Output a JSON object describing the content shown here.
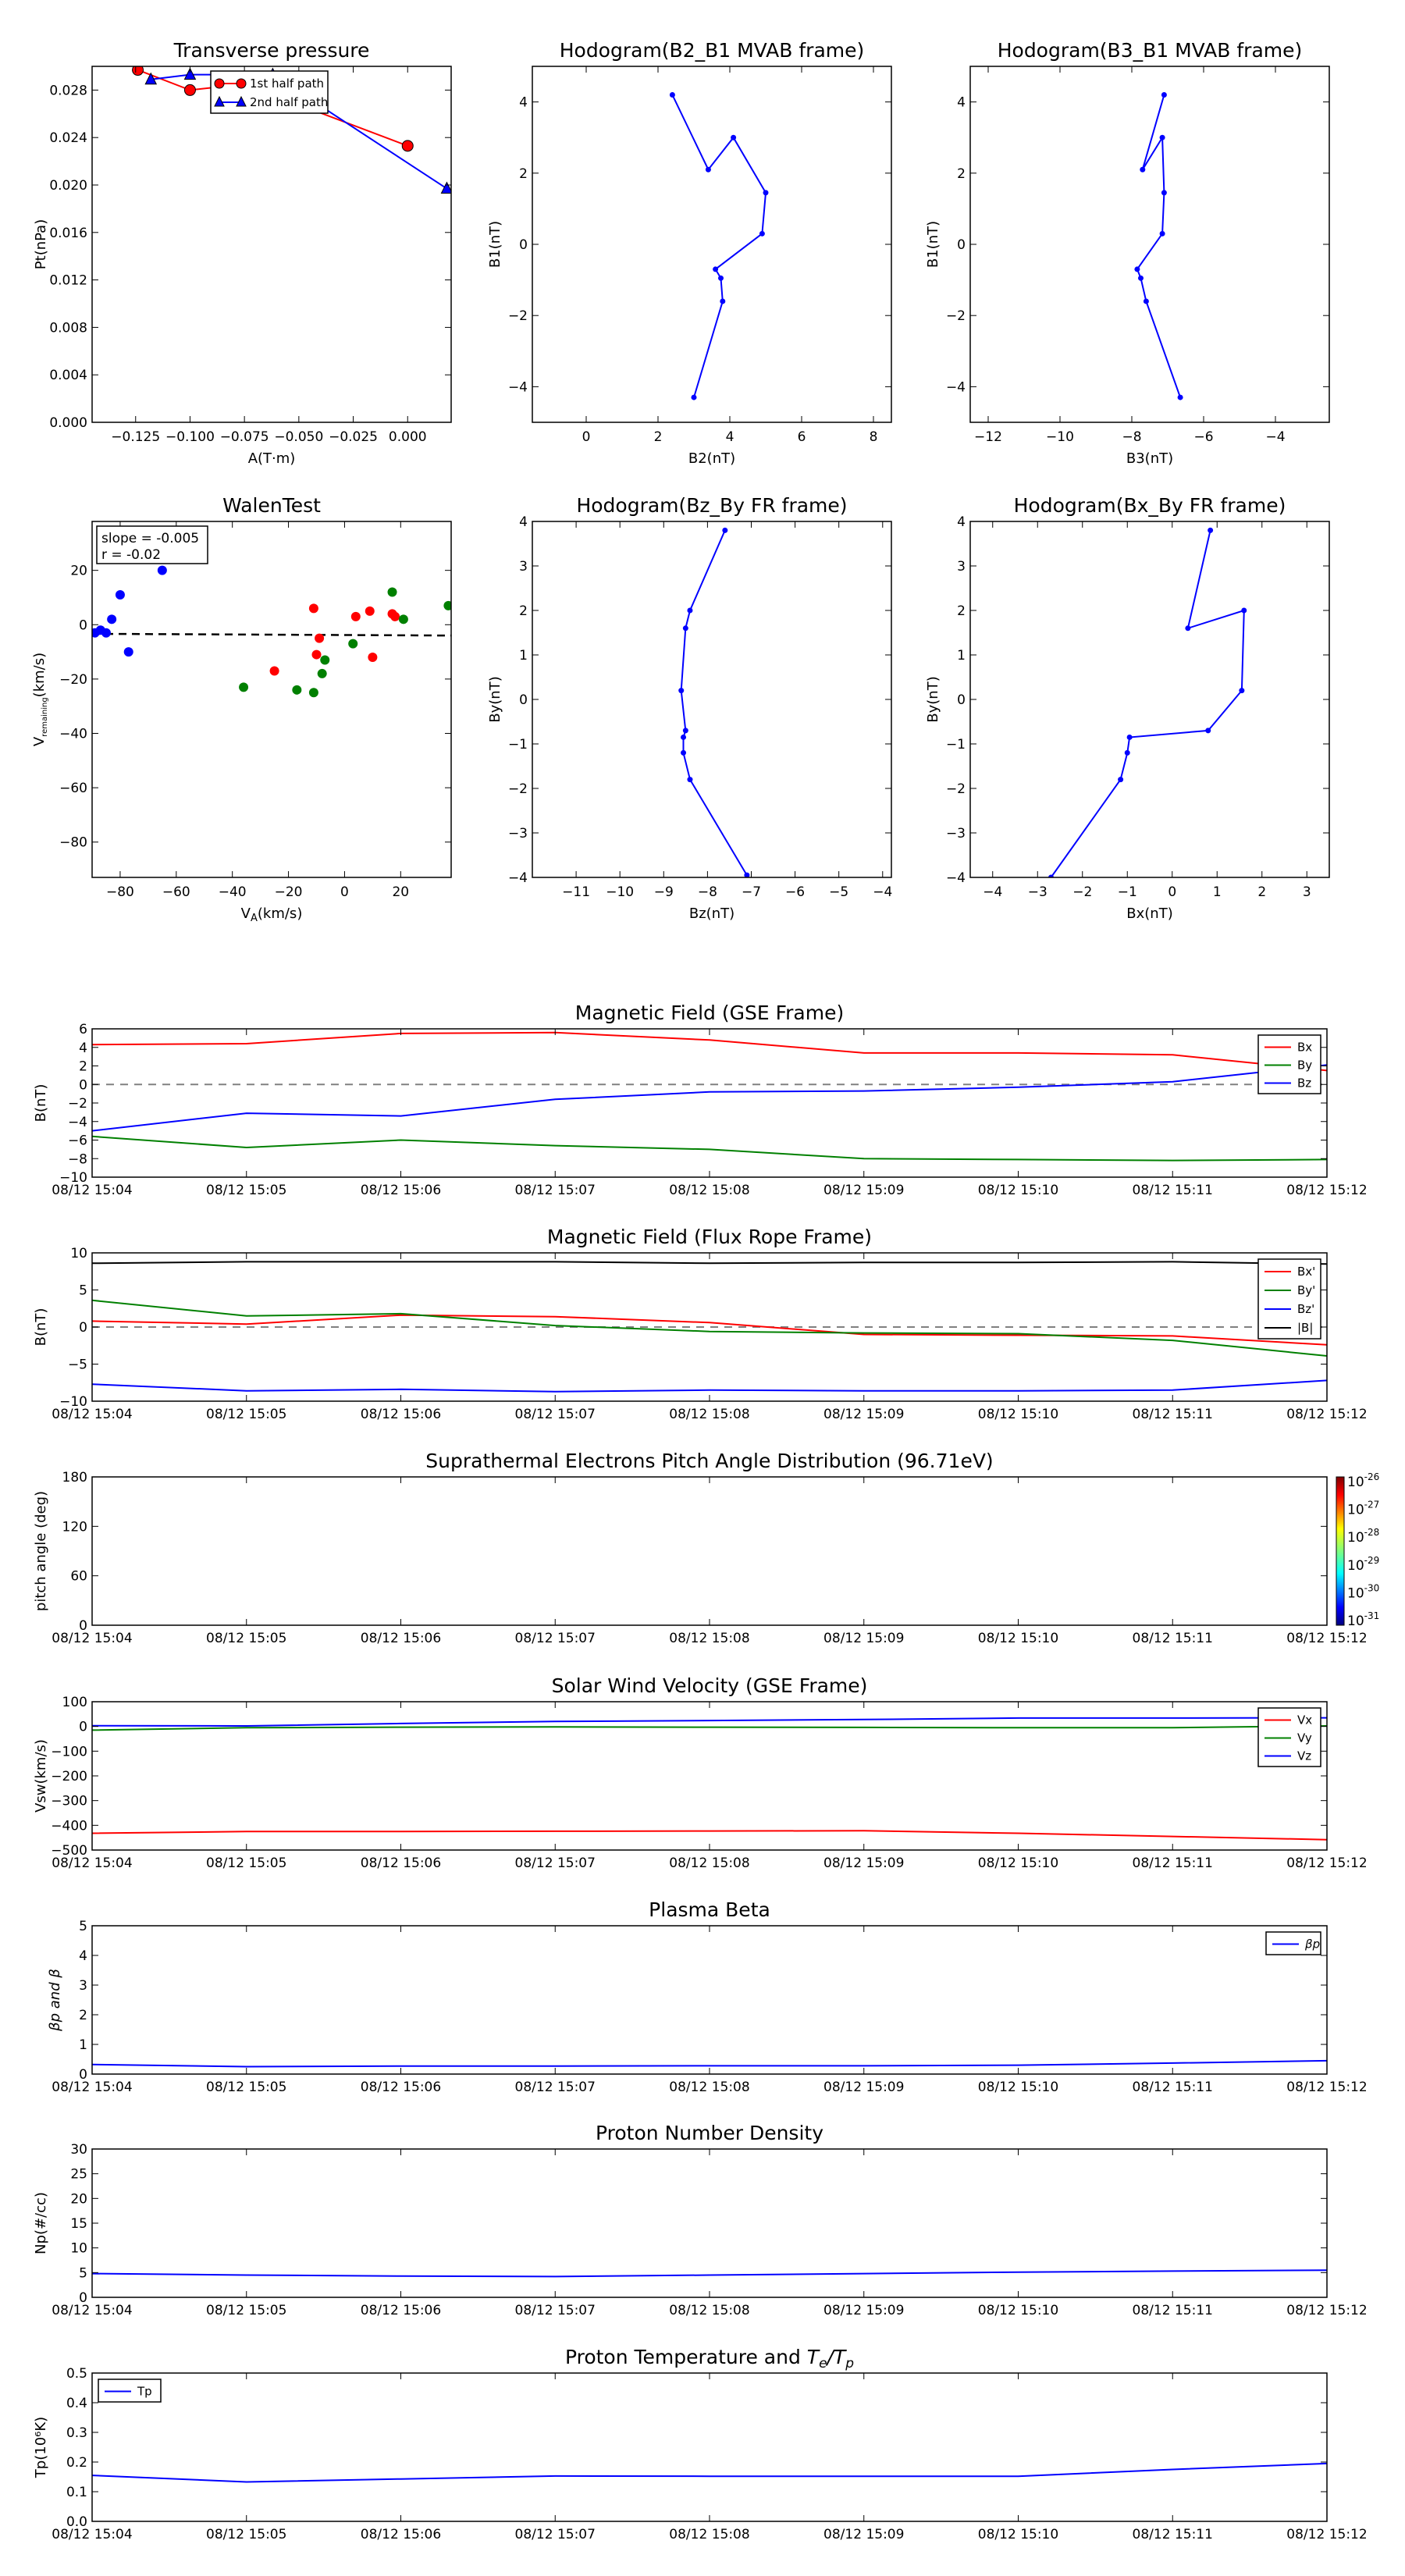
{
  "chart_data": [
    {
      "id": "tp",
      "type": "line",
      "title": "Transverse pressure",
      "xlabel": "A(T·m)",
      "ylabel": "Pt(nPa)",
      "xlim": [
        -0.145,
        0.02
      ],
      "ylim": [
        0,
        0.03
      ],
      "xticks": [
        -0.125,
        -0.1,
        -0.075,
        -0.05,
        -0.025,
        0.0
      ],
      "xtick_labels": [
        "−0.125",
        "−0.100",
        "−0.075",
        "−0.050",
        "−0.025",
        "0.000"
      ],
      "yticks": [
        0,
        0.004,
        0.008,
        0.012,
        0.016,
        0.02,
        0.024,
        0.028
      ],
      "ytick_labels": [
        "0.000",
        "0.004",
        "0.008",
        "0.012",
        "0.016",
        "0.020",
        "0.024",
        "0.028"
      ],
      "legend": {
        "location": "top-center"
      },
      "series": [
        {
          "name": "1st half path",
          "color": "#ff0000",
          "marker": "circle",
          "x": [
            -0.124,
            -0.1,
            -0.075,
            0.0
          ],
          "y": [
            0.0297,
            0.028,
            0.0285,
            0.0233
          ]
        },
        {
          "name": "2nd half path",
          "color": "#0000ff",
          "marker": "triangle",
          "x": [
            -0.118,
            -0.1,
            -0.062,
            0.018
          ],
          "y": [
            0.0289,
            0.0293,
            0.0293,
            0.0197
          ]
        }
      ]
    },
    {
      "id": "h21",
      "type": "line",
      "title": "Hodogram(B2_B1 MVAB frame)",
      "xlabel": "B2(nT)",
      "ylabel": "B1(nT)",
      "xlim": [
        -1.5,
        8.5
      ],
      "ylim": [
        -5,
        5
      ],
      "xticks": [
        0,
        2,
        4,
        6,
        8
      ],
      "xtick_labels": [
        "0",
        "2",
        "4",
        "6",
        "8"
      ],
      "yticks": [
        -4,
        -2,
        0,
        2,
        4
      ],
      "ytick_labels": [
        "−4",
        "−2",
        "0",
        "2",
        "4"
      ],
      "series": [
        {
          "color": "#0000ff",
          "marker": "dot",
          "x": [
            2.4,
            3.4,
            4.1,
            5.0,
            4.9,
            3.6,
            3.75,
            3.8,
            3.0
          ],
          "y": [
            4.2,
            2.1,
            3.0,
            1.45,
            0.3,
            -0.7,
            -0.95,
            -1.6,
            -4.3
          ]
        }
      ]
    },
    {
      "id": "h31",
      "type": "line",
      "title": "Hodogram(B3_B1 MVAB frame)",
      "xlabel": "B3(nT)",
      "ylabel": "B1(nT)",
      "xlim": [
        -12.5,
        -2.5
      ],
      "ylim": [
        -5,
        5
      ],
      "xticks": [
        -12,
        -10,
        -8,
        -6,
        -4
      ],
      "xtick_labels": [
        "−12",
        "−10",
        "−8",
        "−6",
        "−4"
      ],
      "yticks": [
        -4,
        -2,
        0,
        2,
        4
      ],
      "ytick_labels": [
        "−4",
        "−2",
        "0",
        "2",
        "4"
      ],
      "series": [
        {
          "color": "#0000ff",
          "marker": "dot",
          "x": [
            -7.1,
            -7.7,
            -7.15,
            -7.1,
            -7.15,
            -7.85,
            -7.75,
            -7.6,
            -6.65
          ],
          "y": [
            4.2,
            2.1,
            3.0,
            1.45,
            0.3,
            -0.7,
            -0.95,
            -1.6,
            -4.3
          ]
        }
      ]
    },
    {
      "id": "walen",
      "type": "scatter",
      "title": "WalenTest",
      "xlabel": "V_A(km/s)",
      "ylabel": "V_remaining(km/s)",
      "xlim": [
        -90,
        38
      ],
      "ylim": [
        -93,
        38
      ],
      "xticks": [
        -80,
        -60,
        -40,
        -20,
        0,
        20
      ],
      "xtick_labels": [
        "−80",
        "−60",
        "−40",
        "−20",
        "0",
        "20"
      ],
      "yticks": [
        -80,
        -60,
        -40,
        -20,
        0,
        20
      ],
      "ytick_labels": [
        "−80",
        "−60",
        "−40",
        "−20",
        "0",
        "20"
      ],
      "annotation": [
        "slope = -0.005",
        "r = -0.02"
      ],
      "fit": {
        "slope": -0.005,
        "intercept": -3.8,
        "color": "#000000",
        "style": "dashed"
      },
      "series": [
        {
          "color": "#0000ff",
          "x": [
            -89,
            -87,
            -85,
            -83,
            -80,
            -77,
            -65
          ],
          "y": [
            -3,
            -2,
            -3,
            2,
            11,
            -10,
            20
          ]
        },
        {
          "color": "#ff0000",
          "x": [
            -25,
            -11,
            -10,
            -9,
            4,
            9,
            17,
            18,
            10
          ],
          "y": [
            -17,
            6,
            -11,
            -5,
            3,
            5,
            4,
            3,
            -12
          ]
        },
        {
          "color": "#008000",
          "x": [
            -36,
            -17,
            -11,
            -8,
            -7,
            3,
            17,
            21,
            37
          ],
          "y": [
            -23,
            -24,
            -25,
            -18,
            -13,
            -7,
            12,
            2,
            7
          ]
        }
      ]
    },
    {
      "id": "hzy",
      "type": "line",
      "title": "Hodogram(Bz_By FR frame)",
      "xlabel": "Bz(nT)",
      "ylabel": "By(nT)",
      "xlim": [
        -12,
        -3.8
      ],
      "ylim": [
        -4,
        4
      ],
      "xticks": [
        -11,
        -10,
        -9,
        -8,
        -7,
        -6,
        -5,
        -4
      ],
      "xtick_labels": [
        "−11",
        "−10",
        "−9",
        "−8",
        "−7",
        "−6",
        "−5",
        "−4"
      ],
      "yticks": [
        -4,
        -3,
        -2,
        -1,
        0,
        1,
        2,
        3,
        4
      ],
      "ytick_labels": [
        "−4",
        "−3",
        "−2",
        "−1",
        "0",
        "1",
        "2",
        "3",
        "4"
      ],
      "series": [
        {
          "color": "#0000ff",
          "marker": "dot",
          "x": [
            -7.6,
            -8.4,
            -8.5,
            -8.6,
            -8.5,
            -8.55,
            -8.55,
            -8.4,
            -7.1
          ],
          "y": [
            3.8,
            2.0,
            1.6,
            0.2,
            -0.7,
            -0.85,
            -1.2,
            -1.8,
            -3.95
          ]
        }
      ]
    },
    {
      "id": "hxy",
      "type": "line",
      "title": "Hodogram(Bx_By FR frame)",
      "xlabel": "Bx(nT)",
      "ylabel": "By(nT)",
      "xlim": [
        -4.5,
        3.5
      ],
      "ylim": [
        -4,
        4
      ],
      "xticks": [
        -4,
        -3,
        -2,
        -1,
        0,
        1,
        2,
        3
      ],
      "xtick_labels": [
        "−4",
        "−3",
        "−2",
        "−1",
        "0",
        "1",
        "2",
        "3"
      ],
      "yticks": [
        -4,
        -3,
        -2,
        -1,
        0,
        1,
        2,
        3,
        4
      ],
      "ytick_labels": [
        "−4",
        "−3",
        "−2",
        "−1",
        "0",
        "1",
        "2",
        "3",
        "4"
      ],
      "series": [
        {
          "color": "#0000ff",
          "marker": "dot",
          "x": [
            0.85,
            0.35,
            1.6,
            1.55,
            0.8,
            -0.95,
            -1.0,
            -1.15,
            -2.7
          ],
          "y": [
            3.8,
            1.6,
            2.0,
            0.2,
            -0.7,
            -0.85,
            -1.2,
            -1.8,
            -4.0
          ]
        }
      ]
    },
    {
      "id": "mag_gse",
      "type": "line",
      "title": "Magnetic Field (GSE Frame)",
      "xlabel": "",
      "ylabel": "B(nT)",
      "xlim": [
        0,
        8
      ],
      "ylim": [
        -10,
        6
      ],
      "x": [
        0,
        1,
        2,
        3,
        4,
        5,
        6,
        7,
        8
      ],
      "x_tick_labels": [
        "08/12 15:04",
        "08/12 15:05",
        "08/12 15:06",
        "08/12 15:07",
        "08/12 15:08",
        "08/12 15:09",
        "08/12 15:10",
        "08/12 15:11",
        "08/12 15:12"
      ],
      "yticks": [
        -10,
        -8,
        -6,
        -4,
        -2,
        0,
        2,
        4,
        6
      ],
      "ytick_labels": [
        "−10",
        "−8",
        "−6",
        "−4",
        "−2",
        "0",
        "2",
        "4",
        "6"
      ],
      "zero_line": true,
      "legend": {
        "location": "top-right"
      },
      "series": [
        {
          "name": "Bx",
          "color": "#ff0000",
          "values": [
            4.3,
            4.4,
            5.5,
            5.6,
            4.8,
            3.4,
            3.4,
            3.2,
            1.5
          ]
        },
        {
          "name": "By",
          "color": "#008000",
          "values": [
            -5.6,
            -6.8,
            -6.0,
            -6.6,
            -7.0,
            -8.0,
            -8.1,
            -8.2,
            -8.1
          ]
        },
        {
          "name": "Bz",
          "color": "#0000ff",
          "values": [
            -5.0,
            -3.1,
            -3.4,
            -1.6,
            -0.8,
            -0.7,
            -0.3,
            0.3,
            2.1
          ]
        }
      ]
    },
    {
      "id": "mag_fr",
      "type": "line",
      "title": "Magnetic Field (Flux Rope Frame)",
      "xlabel": "",
      "ylabel": "B(nT)",
      "xlim": [
        0,
        8
      ],
      "ylim": [
        -10,
        10
      ],
      "x": [
        0,
        1,
        2,
        3,
        4,
        5,
        6,
        7,
        8
      ],
      "x_tick_labels": [
        "08/12 15:04",
        "08/12 15:05",
        "08/12 15:06",
        "08/12 15:07",
        "08/12 15:08",
        "08/12 15:09",
        "08/12 15:10",
        "08/12 15:11",
        "08/12 15:12"
      ],
      "yticks": [
        -10,
        -5,
        0,
        5,
        10
      ],
      "ytick_labels": [
        "−10",
        "−5",
        "0",
        "5",
        "10"
      ],
      "zero_line": true,
      "legend": {
        "location": "top-right"
      },
      "series": [
        {
          "name": "Bx'",
          "color": "#ff0000",
          "values": [
            0.8,
            0.4,
            1.6,
            1.4,
            0.6,
            -1.0,
            -1.1,
            -1.2,
            -2.4
          ]
        },
        {
          "name": "By'",
          "color": "#008000",
          "values": [
            3.6,
            1.5,
            1.8,
            0.2,
            -0.6,
            -0.8,
            -0.9,
            -1.8,
            -3.9
          ]
        },
        {
          "name": "Bz'",
          "color": "#0000ff",
          "values": [
            -7.7,
            -8.6,
            -8.4,
            -8.7,
            -8.5,
            -8.6,
            -8.6,
            -8.5,
            -7.2
          ]
        },
        {
          "name": "|B|",
          "color": "#000000",
          "values": [
            8.6,
            8.8,
            8.8,
            8.8,
            8.6,
            8.7,
            8.7,
            8.8,
            8.5
          ]
        }
      ]
    },
    {
      "id": "pad",
      "type": "heatmap",
      "title": "Suprathermal Electrons Pitch Angle Distribution (96.71eV)",
      "xlabel": "",
      "ylabel": "pitch angle (deg)",
      "xlim": [
        0,
        8
      ],
      "ylim": [
        0,
        180
      ],
      "x_tick_labels": [
        "08/12 15:04",
        "08/12 15:05",
        "08/12 15:06",
        "08/12 15:07",
        "08/12 15:08",
        "08/12 15:09",
        "08/12 15:10",
        "08/12 15:11",
        "08/12 15:12"
      ],
      "yticks": [
        0,
        60,
        120,
        180
      ],
      "ytick_labels": [
        "0",
        "60",
        "120",
        "180"
      ],
      "colorbar_exponents": [
        "-26",
        "-27",
        "-28",
        "-29",
        "-30",
        "-31"
      ],
      "colorbar_base": "10"
    },
    {
      "id": "vsw",
      "type": "line",
      "title": "Solar Wind Velocity (GSE Frame)",
      "xlabel": "",
      "ylabel": "Vsw(km/s)",
      "xlim": [
        0,
        8
      ],
      "ylim": [
        -500,
        100
      ],
      "x": [
        0,
        1,
        2,
        3,
        4,
        5,
        6,
        7,
        8
      ],
      "x_tick_labels": [
        "08/12 15:04",
        "08/12 15:05",
        "08/12 15:06",
        "08/12 15:07",
        "08/12 15:08",
        "08/12 15:09",
        "08/12 15:10",
        "08/12 15:11",
        "08/12 15:12"
      ],
      "yticks": [
        -500,
        -400,
        -300,
        -200,
        -100,
        0,
        100
      ],
      "ytick_labels": [
        "−500",
        "−400",
        "−300",
        "−200",
        "−100",
        "0",
        "100"
      ],
      "legend": {
        "location": "top-right"
      },
      "series": [
        {
          "name": "Vx",
          "color": "#ff0000",
          "values": [
            -432,
            -425,
            -425,
            -424,
            -423,
            -422,
            -432,
            -445,
            -458
          ]
        },
        {
          "name": "Vy",
          "color": "#008000",
          "values": [
            -15,
            -5,
            -3,
            -2,
            -3,
            -4,
            -5,
            -5,
            2
          ]
        },
        {
          "name": "Vz",
          "color": "#0000ff",
          "values": [
            3,
            2,
            12,
            20,
            24,
            28,
            34,
            34,
            35
          ]
        }
      ]
    },
    {
      "id": "beta",
      "type": "line",
      "title": "Plasma Beta",
      "xlabel": "",
      "ylabel": "βp and β",
      "xlim": [
        0,
        8
      ],
      "ylim": [
        0,
        5
      ],
      "x": [
        0,
        1,
        2,
        3,
        4,
        5,
        6,
        7,
        8
      ],
      "x_tick_labels": [
        "08/12 15:04",
        "08/12 15:05",
        "08/12 15:06",
        "08/12 15:07",
        "08/12 15:08",
        "08/12 15:09",
        "08/12 15:10",
        "08/12 15:11",
        "08/12 15:12"
      ],
      "yticks": [
        0,
        1,
        2,
        3,
        4,
        5
      ],
      "ytick_labels": [
        "0",
        "1",
        "2",
        "3",
        "4",
        "5"
      ],
      "legend": {
        "location": "top-right"
      },
      "series": [
        {
          "name": "βp",
          "color": "#0000ff",
          "values": [
            0.32,
            0.25,
            0.27,
            0.27,
            0.28,
            0.28,
            0.3,
            0.37,
            0.45
          ]
        }
      ]
    },
    {
      "id": "np",
      "type": "line",
      "title": "Proton Number Density",
      "xlabel": "",
      "ylabel": "Np(#/cc)",
      "xlim": [
        0,
        8
      ],
      "ylim": [
        0,
        30
      ],
      "x": [
        0,
        1,
        2,
        3,
        4,
        5,
        6,
        7,
        8
      ],
      "x_tick_labels": [
        "08/12 15:04",
        "08/12 15:05",
        "08/12 15:06",
        "08/12 15:07",
        "08/12 15:08",
        "08/12 15:09",
        "08/12 15:10",
        "08/12 15:11",
        "08/12 15:12"
      ],
      "yticks": [
        0,
        5,
        10,
        15,
        20,
        25,
        30
      ],
      "ytick_labels": [
        "0",
        "5",
        "10",
        "15",
        "20",
        "25",
        "30"
      ],
      "series": [
        {
          "color": "#0000ff",
          "values": [
            4.8,
            4.5,
            4.3,
            4.2,
            4.5,
            4.8,
            5.1,
            5.3,
            5.5
          ]
        }
      ]
    },
    {
      "id": "tp_temp",
      "type": "line",
      "title": "Proton Temperature and Te/Tp",
      "xlabel": "",
      "ylabel": "Tp(10⁶K)",
      "xlim": [
        0,
        8
      ],
      "ylim": [
        0,
        0.5
      ],
      "x": [
        0,
        1,
        2,
        3,
        4,
        5,
        6,
        7,
        8
      ],
      "x_tick_labels": [
        "08/12 15:04",
        "08/12 15:05",
        "08/12 15:06",
        "08/12 15:07",
        "08/12 15:08",
        "08/12 15:09",
        "08/12 15:10",
        "08/12 15:11",
        "08/12 15:12"
      ],
      "yticks": [
        0,
        0.1,
        0.2,
        0.3,
        0.4,
        0.5
      ],
      "ytick_labels": [
        "0.0",
        "0.1",
        "0.2",
        "0.3",
        "0.4",
        "0.5"
      ],
      "legend": {
        "location": "top-left"
      },
      "series": [
        {
          "name": "Tp",
          "color": "#0000ff",
          "values": [
            0.155,
            0.133,
            0.143,
            0.153,
            0.152,
            0.152,
            0.152,
            0.175,
            0.195
          ]
        }
      ]
    }
  ]
}
